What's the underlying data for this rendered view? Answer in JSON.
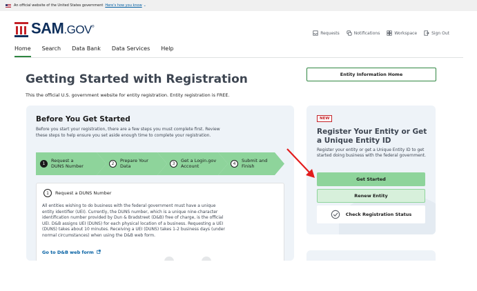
{
  "banner": {
    "text": "An official website of the United States government",
    "link": "Here's how you know"
  },
  "brand": {
    "name": "SAM",
    "suffix": ".GOV",
    "mark": "®"
  },
  "utility_nav": {
    "requests": "Requests",
    "notifications": "Notifications",
    "workspace": "Workspace",
    "sign_out": "Sign Out"
  },
  "main_nav": {
    "tabs": [
      {
        "label": "Home",
        "active": true
      },
      {
        "label": "Search"
      },
      {
        "label": "Data Bank"
      },
      {
        "label": "Data Services"
      },
      {
        "label": "Help"
      }
    ]
  },
  "page": {
    "title": "Getting Started with Registration",
    "subtitle": "This the official U.S. government website for entity registration. Entity registration is FREE.",
    "entity_home_button": "Entity Information Home"
  },
  "before_start": {
    "heading": "Before You Get Started",
    "intro": "Before you start your registration, there are a few steps you must complete first. Review these steps to help ensure you set aside enough time to complete your registration.",
    "steps": [
      {
        "num": "1",
        "line1": "Request a",
        "line2": "DUNS Number"
      },
      {
        "num": "2",
        "line1": "Prepare Your",
        "line2": "Data"
      },
      {
        "num": "3",
        "line1": "Get a Login.gov",
        "line2": "Account"
      },
      {
        "num": "4",
        "line1": "Submit and",
        "line2": "Finish"
      }
    ],
    "detail": {
      "num": "1",
      "heading": "Request a DUNS Number",
      "body": "All entities wishing to do business with the federal government must have a unique entity identifier (UEI). Currently, the DUNS number, which is a unique nine-character identification number provided by Dun & Bradstreet (D&B) free of charge, is the official UEI. D&B assigns UEI (DUNS) for each physical location of a business. Requesting a UEI (DUNS) takes about 10 minutes. Receiving a UEI (DUNS) takes 1-2 business days (under normal circumstances) when using the D&B web form.",
      "link": "Go to D&B web form"
    }
  },
  "register_card": {
    "badge": "NEW",
    "heading": "Register Your Entity or Get a Unique Entity ID",
    "description": "Register your entity or get a Unique Entity ID to get started doing business with the federal government.",
    "get_started": "Get Started",
    "renew": "Renew Entity",
    "check_status": "Check Registration Status"
  },
  "colors": {
    "primary_green": "#8ed49b",
    "border_green": "#2e8540",
    "brand_navy": "#0d2e5b",
    "brand_red": "#c42127",
    "card_bg": "#eef3f8",
    "arrow_red": "#e31c1c"
  },
  "icons": {
    "requests": "inbox-icon",
    "notifications": "chat-icon",
    "workspace": "grid-icon",
    "sign_out": "sign-out-icon",
    "check": "check-circle-icon",
    "external": "external-link-icon"
  }
}
